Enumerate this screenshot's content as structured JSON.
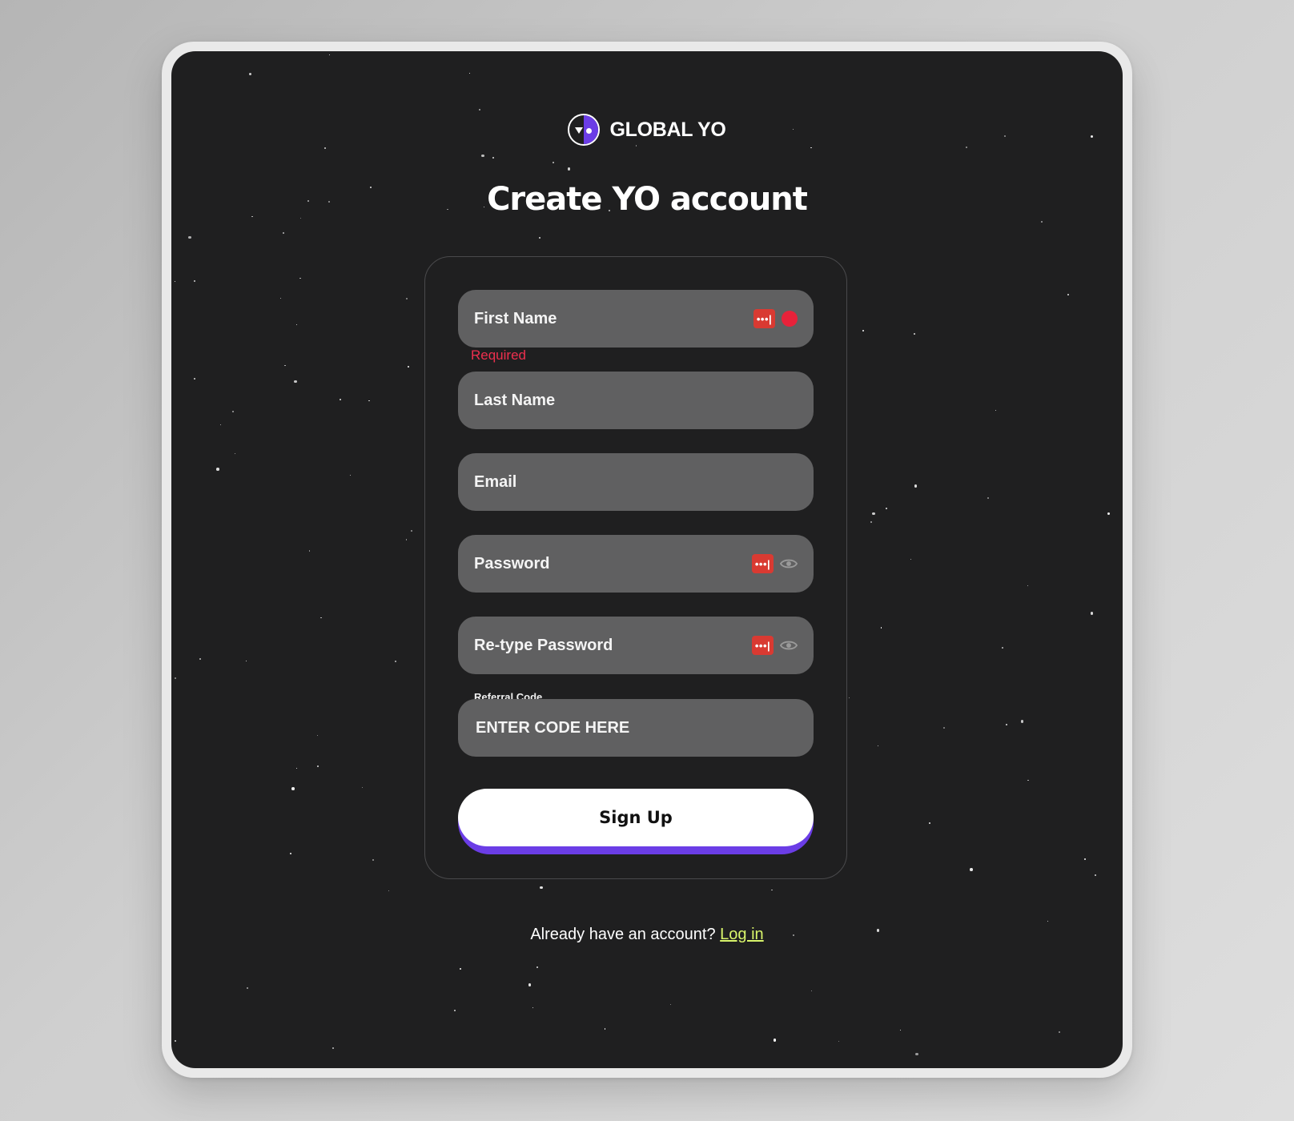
{
  "brand": {
    "name": "GLOBAL YO",
    "logo_icon": "global-yo-logo-icon"
  },
  "title": "Create YO account",
  "form": {
    "first_name": {
      "label": "First Name",
      "error": "Required"
    },
    "last_name": {
      "label": "Last Name"
    },
    "email": {
      "label": "Email"
    },
    "password": {
      "label": "Password"
    },
    "retype_password": {
      "label": "Re-type Password"
    },
    "referral": {
      "label": "Referral Code",
      "placeholder": "ENTER CODE HERE"
    },
    "signup_label": "Sign Up",
    "password_manager_glyph": "•••|"
  },
  "footer": {
    "prompt": "Already have an account?",
    "login_label": "Log in"
  },
  "colors": {
    "accent": "#6b3de6",
    "background": "#1f1f20",
    "field": "#606061",
    "error": "#ee2f4e",
    "link": "#d9f56b",
    "password_manager": "#d93a32"
  }
}
